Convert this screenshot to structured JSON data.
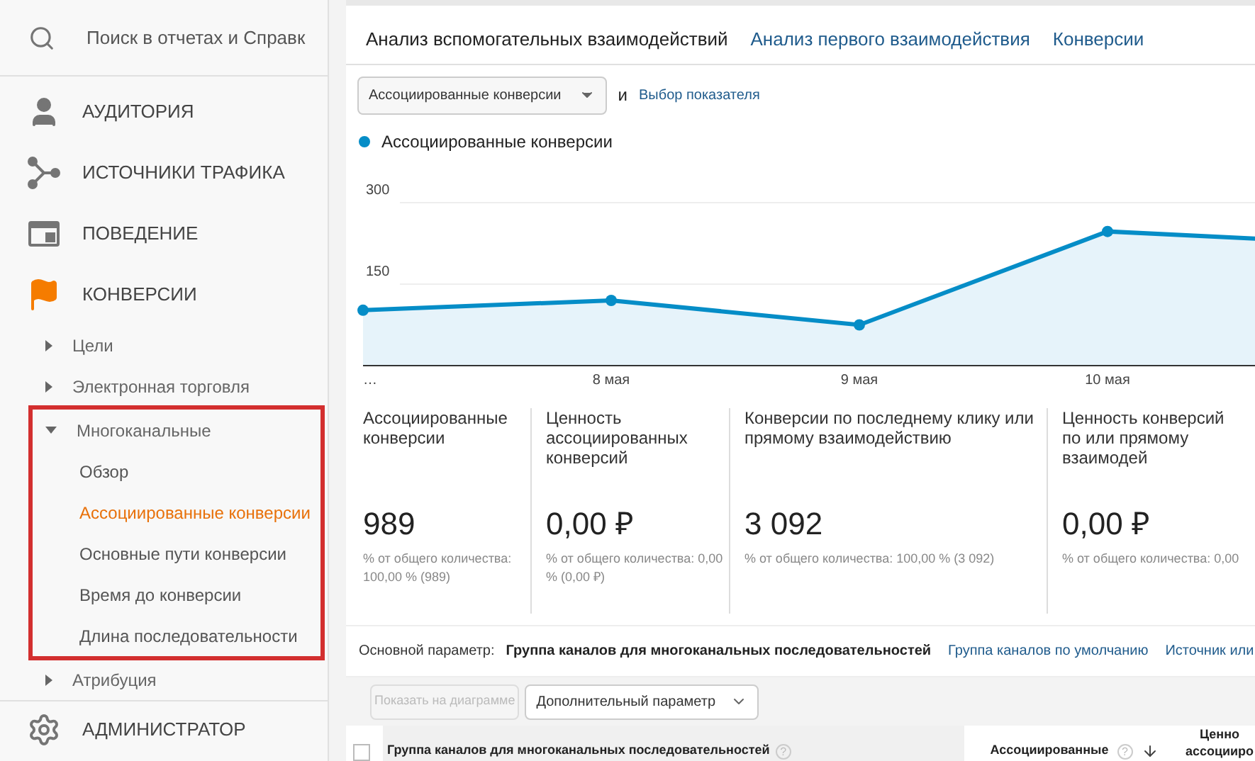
{
  "sidebar": {
    "search": {
      "placeholder": "Поиск в отчетах и Справк"
    },
    "sections": [
      {
        "kind": "audience",
        "label": "АУДИТОРИЯ",
        "active": false
      },
      {
        "kind": "acquisition",
        "label": "ИСТОЧНИКИ ТРАФИКА",
        "active": false
      },
      {
        "kind": "behavior",
        "label": "ПОВЕДЕНИЕ",
        "active": false
      },
      {
        "kind": "conversions",
        "label": "КОНВЕРСИИ",
        "active": true,
        "children": [
          {
            "label": "Цели",
            "expanded": false,
            "highlighted": false
          },
          {
            "label": "Электронная торговля",
            "expanded": false,
            "highlighted": false
          },
          {
            "label": "Многоканальные",
            "expanded": true,
            "highlighted": true,
            "children": [
              {
                "label": "Обзор",
                "selected": false
              },
              {
                "label": "Ассоциированные конверсии",
                "selected": true
              },
              {
                "label": "Основные пути конверсии",
                "selected": false
              },
              {
                "label": "Время до конверсии",
                "selected": false
              },
              {
                "label": "Длина последовательности",
                "selected": false
              }
            ]
          },
          {
            "label": "Атрибуция",
            "expanded": false,
            "highlighted": false
          }
        ]
      }
    ],
    "footer": {
      "kind": "admin",
      "label": "АДМИНИСТРАТОР"
    }
  },
  "tabs": [
    {
      "label": "Анализ вспомогательных взаимодействий",
      "selected": true
    },
    {
      "label": "Анализ первого взаимодействия",
      "selected": false
    },
    {
      "label": "Конверсии",
      "selected": false
    }
  ],
  "metric_picker": {
    "value": "Ассоциированные конверсии",
    "connector": "и",
    "link": "Выбор показателя"
  },
  "chart": {
    "legend": {
      "label": "Ассоциированные конверсии",
      "color": "#058dc7"
    },
    "chart_data": {
      "type": "area",
      "categories": [
        "…",
        "8 мая",
        "9 мая",
        "10 мая",
        null
      ],
      "series": [
        {
          "color": "#058dc7",
          "values": [
            102,
            120,
            75,
            247,
            225
          ]
        }
      ],
      "ylim": [
        0,
        300
      ],
      "yticks": [
        150,
        300
      ]
    }
  },
  "cards": [
    {
      "label": "Ассоциированные конверсии",
      "value": "989",
      "note": "% от общего количества: 100,00 % (989)"
    },
    {
      "label": "Ценность ассоциированных конверсий",
      "value": "0,00 ₽",
      "note": "% от общего количества: 0,00 % (0,00 ₽)"
    },
    {
      "label": "Конверсии по последнему клику или прямому взаимодействию",
      "value": "3 092",
      "note": "% от общего количества: 100,00 % (3 092)"
    },
    {
      "label": "Ценность конверсий по или прямому взаимодей",
      "value": "0,00 ₽",
      "note": "% от общего количества: 0,00"
    }
  ],
  "primary_dimension": {
    "label": "Основной параметр:",
    "options": [
      {
        "label": "Группа каналов для многоканальных последовательностей",
        "selected": true
      },
      {
        "label": "Группа каналов по умолчанию",
        "selected": false
      },
      {
        "label": "Источник или",
        "selected": false
      }
    ]
  },
  "toolbar": {
    "chart_button": {
      "label": "Показать на диаграмме",
      "disabled": true
    },
    "secondary": {
      "label": "Дополнительный параметр"
    }
  },
  "table": {
    "select_all": {
      "checked": false
    },
    "columns": [
      {
        "label": "Группа каналов для многоканальных последовательностей",
        "help": "?",
        "sorted": false
      },
      {
        "label": "Ассоциированные",
        "help": "?",
        "sorted": true
      },
      {
        "label": "Ценно ассоцииро",
        "sorted": false
      }
    ]
  }
}
